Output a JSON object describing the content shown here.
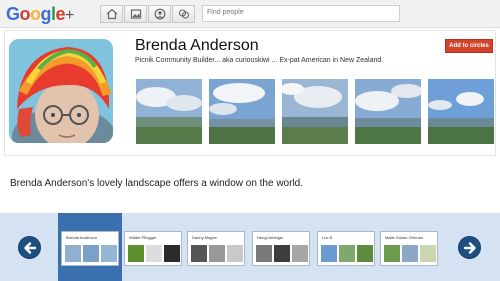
{
  "topbar": {
    "logo_text": "Google",
    "logo_plus": "+",
    "search_placeholder": "Find people",
    "nav_icons": [
      "home-icon",
      "photos-icon",
      "profile-icon",
      "circles-icon"
    ]
  },
  "profile": {
    "name": "Brenda Anderson",
    "tagline": "Picnik Community Builder... aka curiouskiwi ... Ex-pat American in New Zealand.",
    "add_button": "Add to circles"
  },
  "caption": "Brenda Anderson's lovely landscape offers a window on the world.",
  "filmstrip": {
    "items": [
      {
        "name": "Brenda Anderson"
      },
      {
        "name": "Walter Pflugger"
      },
      {
        "name": "Danny Magee"
      },
      {
        "name": "Hengi Arbinger"
      },
      {
        "name": "Luc B"
      },
      {
        "name": "Malte Gullan Orhman"
      }
    ]
  },
  "colors": {
    "add_button": "#d2432b",
    "filmstrip_bg": "#d5e2f1",
    "selected_card": "#3a6fb0",
    "arrow": "#1f4e82"
  }
}
